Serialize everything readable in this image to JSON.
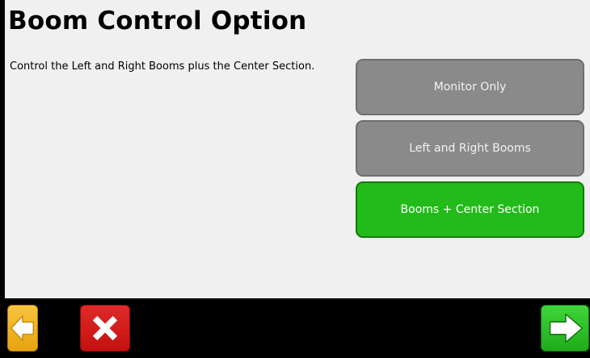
{
  "header": {
    "title": "Boom Control Option"
  },
  "description": {
    "text": "Control the Left and Right Booms plus the Center Section."
  },
  "options": [
    {
      "label": "Monitor Only",
      "selected": false
    },
    {
      "label": "Left and Right Booms",
      "selected": false
    },
    {
      "label": "Booms + Center Section",
      "selected": true
    }
  ],
  "footer": {
    "back_icon": "arrow-left-icon",
    "cancel_icon": "close-icon",
    "next_icon": "arrow-right-icon"
  },
  "colors": {
    "background": "#f0f0f0",
    "option_default": "#8a8a8a",
    "option_selected": "#22bb1a",
    "back_button": "#f0b323",
    "cancel_button": "#d21c1c",
    "next_button": "#2fc42a"
  }
}
